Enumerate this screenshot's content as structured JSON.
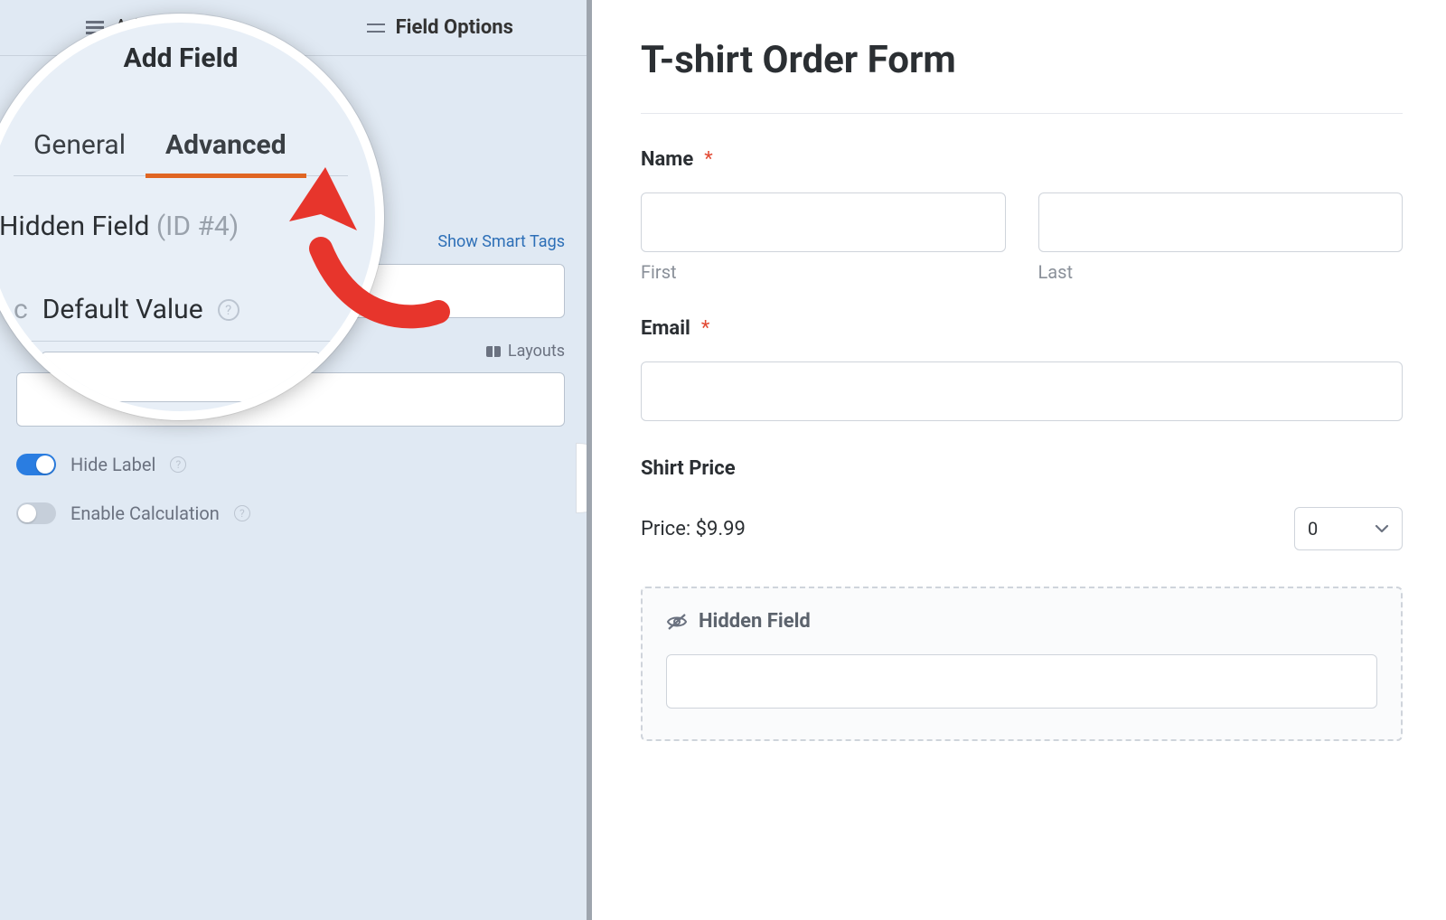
{
  "top_tabs": {
    "add_fields": "Add Fields",
    "field_options": "Field Options"
  },
  "sub_tabs": {
    "general": "General",
    "advanced": "Advanced",
    "stub": "Gen"
  },
  "field": {
    "name": "Hidden Field",
    "id_label": "(ID #4)"
  },
  "options": {
    "default_value": "Default Value",
    "smart_tags": "Show Smart Tags",
    "layouts": "Layouts",
    "hide_label": "Hide Label",
    "enable_calc": "Enable Calculation",
    "hide_label_on": true,
    "enable_calc_on": false,
    "c_stub": "c"
  },
  "magnifier": {
    "top_fragment": "Add Field"
  },
  "form": {
    "title": "T-shirt Order Form",
    "name": {
      "label": "Name",
      "required": "*",
      "first_sub": "First",
      "last_sub": "Last"
    },
    "email": {
      "label": "Email",
      "required": "*"
    },
    "shirt": {
      "label": "Shirt Price",
      "price_text": "Price: $9.99",
      "qty_value": "0"
    },
    "hidden": {
      "label": "Hidden Field"
    }
  }
}
